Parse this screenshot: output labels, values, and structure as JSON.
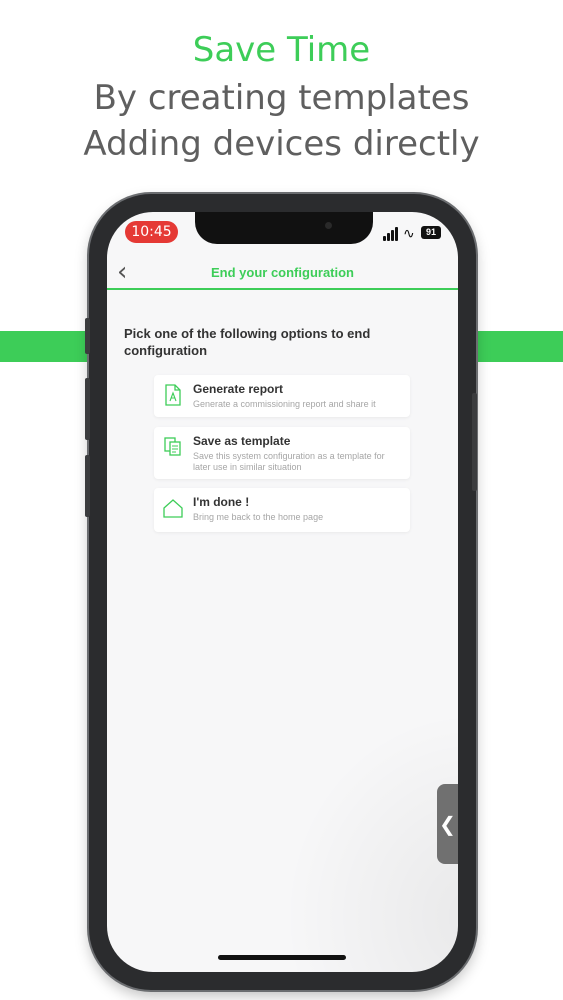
{
  "headline": {
    "line1": "Save Time",
    "line2": "By creating templates",
    "line3": "Adding devices directly"
  },
  "status_bar": {
    "time": "10:45",
    "battery": "91"
  },
  "nav": {
    "back_icon": "chevron-left-icon",
    "title": "End your configuration"
  },
  "intro_text": "Pick one of the following options to end configuration",
  "options": [
    {
      "title": "Generate report",
      "subtitle": "Generate a commissioning report and share it",
      "icon": "pdf-file-icon"
    },
    {
      "title": "Save as template",
      "subtitle": "Save this system configuration as a template for later use in similar situation",
      "icon": "copy-documents-icon"
    },
    {
      "title": "I'm done !",
      "subtitle": "Bring me back to the home page",
      "icon": "home-icon"
    }
  ],
  "colors": {
    "accent": "#3dcd58",
    "time_pill": "#e53935",
    "headline_gray": "#5f5f5f"
  }
}
